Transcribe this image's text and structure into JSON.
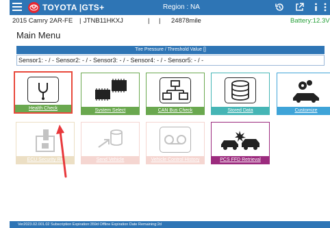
{
  "titlebar": {
    "brand": "TOYOTA |GTS+",
    "region": "Region : NA",
    "icons": [
      "menu-icon",
      "toyota-logo-icon",
      "history-icon",
      "external-link-icon",
      "info-icon",
      "more-vert-icon"
    ]
  },
  "vehicle": {
    "model": "2015 Camry 2AR-FE",
    "sep1": "|",
    "vin": "JTNB11HKXJ",
    "sep2": "|",
    "sep3": "|",
    "mileage": "24878mile",
    "battery": "Battery:12.3V"
  },
  "page_title": "Main Menu",
  "tpms": {
    "header": "Tire Pressure / Threshold Value []",
    "values": "Sensor1: - / - Sensor2: - / - Sensor3: - / - Sensor4: - / - Sensor5: - / -"
  },
  "tiles": [
    {
      "label": "Health Check",
      "icon": "stethoscope-icon",
      "color": "#6aa84f"
    },
    {
      "label": "System Select",
      "icon": "ecu-chip-icon",
      "color": "#6aa84f"
    },
    {
      "label": "CAN Bus Check",
      "icon": "network-icon",
      "color": "#6aa84f"
    },
    {
      "label": "Stored Data",
      "icon": "database-icon",
      "color": "#45b5b5"
    },
    {
      "label": "Customize",
      "icon": "car-gear-icon",
      "color": "#3fa4d8"
    },
    {
      "label": "ECU Security Re",
      "icon": "key-lock-icon",
      "color": "#c9a55a"
    },
    {
      "label": "Send Vehicle",
      "icon": "upload-data-icon",
      "color": "#e58c7d"
    },
    {
      "label": "Vehicle Control History",
      "icon": "tape-icon",
      "color": "#e58c7d"
    },
    {
      "label": "PCS FFD Retrieval",
      "icon": "collision-icon",
      "color": "#9c2b7e"
    }
  ],
  "status": {
    "text": "Ver2023.02.001.02  Subscription Expiration:359d  Offline Expiration Date Remaining:2d"
  },
  "colors": {
    "primary": "#2e75b5",
    "battery": "#27a03a",
    "highlight": "#e8483b",
    "arrow": "#e8383b"
  }
}
